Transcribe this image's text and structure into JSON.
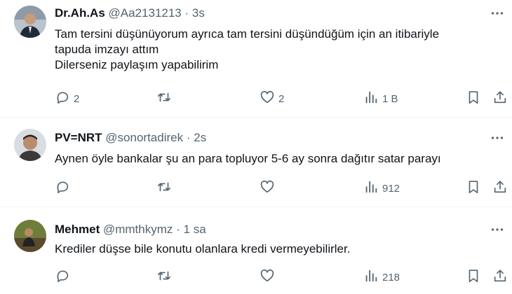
{
  "tweets": [
    {
      "name": "Dr.Ah.As",
      "handle": "@Aa2131213",
      "separator": "·",
      "time": "3s",
      "text": "Tam tersini düşünüyorum ayrıca tam tersini düşündüğüm için an itibariyle\ntapuda imzayı attım\nDilerseniz paylaşım yapabilirim",
      "replies": "2",
      "retweets": "",
      "likes": "2",
      "views": "1 B"
    },
    {
      "name": "PV=NRT",
      "handle": "@sonortadirek",
      "separator": "·",
      "time": "2s",
      "text": "Aynen öyle bankalar şu an para topluyor 5-6 ay sonra dağıtır satar parayı",
      "replies": "",
      "retweets": "",
      "likes": "",
      "views": "912"
    },
    {
      "name": "Mehmet",
      "handle": "@mmthkymz",
      "separator": "·",
      "time": "1 sa",
      "text": "Krediler düşse bile konutu olanlara kredi vermeyebilirler.",
      "replies": "",
      "retweets": "",
      "likes": "",
      "views": "218"
    }
  ],
  "icons": {
    "more": "more-dots-icon",
    "reply": "reply-bubble-icon",
    "retweet": "retweet-arrows-icon",
    "like": "heart-icon",
    "views": "bar-chart-icon",
    "bookmark": "bookmark-icon",
    "share": "share-upload-icon"
  },
  "colors": {
    "text": "#0f1419",
    "muted": "#536471",
    "divider": "#eff3f4"
  }
}
